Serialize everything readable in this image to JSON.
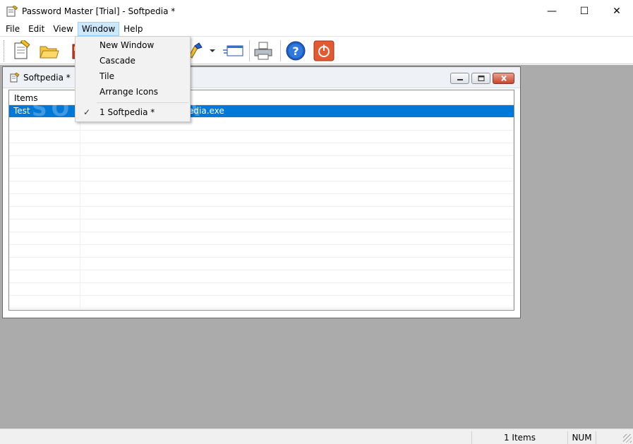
{
  "window": {
    "title": "Password Master [Trial]  - Softpedia *",
    "minimize": "—",
    "maximize": "☐",
    "close": "✕"
  },
  "menubar": {
    "items": [
      {
        "label": "File"
      },
      {
        "label": "Edit"
      },
      {
        "label": "View"
      },
      {
        "label": "Window"
      },
      {
        "label": "Help"
      }
    ]
  },
  "window_menu": {
    "items": [
      {
        "label": "New Window"
      },
      {
        "label": "Cascade"
      },
      {
        "label": "Tile"
      },
      {
        "label": "Arrange Icons"
      },
      {
        "label": "1 Softpedia *",
        "checked": true
      }
    ]
  },
  "toolbar": {
    "icons": [
      "new-document-icon",
      "open-folder-icon",
      "database-icon",
      "tools-icon",
      "arrow-icon",
      "dropdown-icon",
      "run-program-icon",
      "print-icon",
      "help-icon",
      "power-icon"
    ]
  },
  "child_window": {
    "title": "Softpedia *"
  },
  "list": {
    "header": "Items",
    "rows": [
      {
        "name": "Test",
        "path": "edia.exe",
        "selected": true
      }
    ]
  },
  "watermark": "SOFTPEDIA",
  "statusbar": {
    "count": "1 Items",
    "num": "NUM"
  },
  "colors": {
    "selection": "#0078d7",
    "mdi_background": "#ababab",
    "menu_highlight": "#cce8ff"
  }
}
